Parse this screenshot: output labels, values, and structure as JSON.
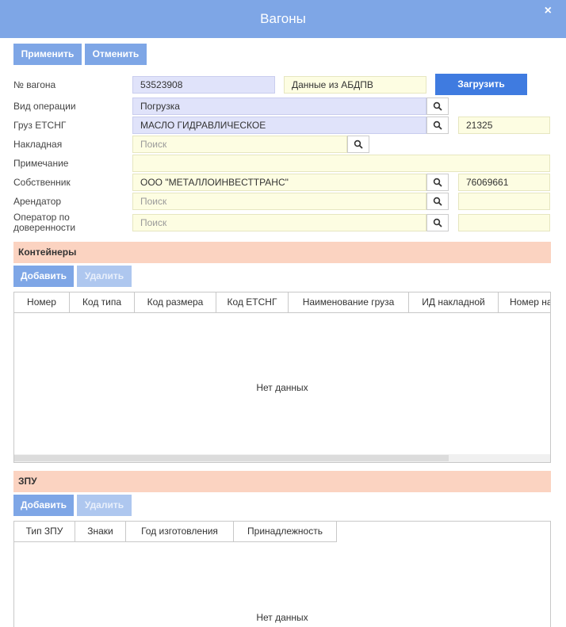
{
  "window": {
    "title": "Вагоны",
    "close": "×"
  },
  "toolbar": {
    "apply": "Применить",
    "cancel": "Отменить"
  },
  "form": {
    "wagon_no": {
      "label": "№ вагона",
      "value": "53523908"
    },
    "abdpv": {
      "label": "Данные из АБДПВ"
    },
    "load_button": "Загрузить",
    "operation": {
      "label": "Вид операции",
      "value": "Погрузка"
    },
    "cargo": {
      "label": "Груз ЕТСНГ",
      "value": "МАСЛО ГИДРАВЛИЧЕСКОЕ",
      "code": "21325"
    },
    "invoice": {
      "label": "Накладная",
      "placeholder": "Поиск"
    },
    "note": {
      "label": "Примечание",
      "value": ""
    },
    "owner": {
      "label": "Собственник",
      "value": "ООО \"МЕТАЛЛОИНВЕСТТРАНС\"",
      "code": "76069661"
    },
    "lessee": {
      "label": "Арендатор",
      "placeholder": "Поиск",
      "code": ""
    },
    "operator": {
      "label_line1": "Оператор по",
      "label_line2": "доверенности",
      "placeholder": "Поиск",
      "code": ""
    }
  },
  "containers": {
    "title": "Контейнеры",
    "add": "Добавить",
    "delete": "Удалить",
    "columns": [
      "Номер",
      "Код типа",
      "Код размера",
      "Код ЕТСНГ",
      "Наименование груза",
      "ИД накладной",
      "Номер на"
    ],
    "empty": "Нет данных"
  },
  "zpu": {
    "title": "ЗПУ",
    "add": "Добавить",
    "delete": "Удалить",
    "columns": [
      "Тип ЗПУ",
      "Знаки",
      "Год изготовления",
      "Принадлежность"
    ],
    "empty": "Нет данных"
  },
  "icons": {
    "search": "search-icon",
    "close": "close-icon"
  },
  "colors": {
    "header": "#7ea6e6",
    "primary": "#3f7be0",
    "section": "#fbd3c1",
    "field_blue": "#e0e3fa",
    "field_yellow": "#fdfde2"
  }
}
